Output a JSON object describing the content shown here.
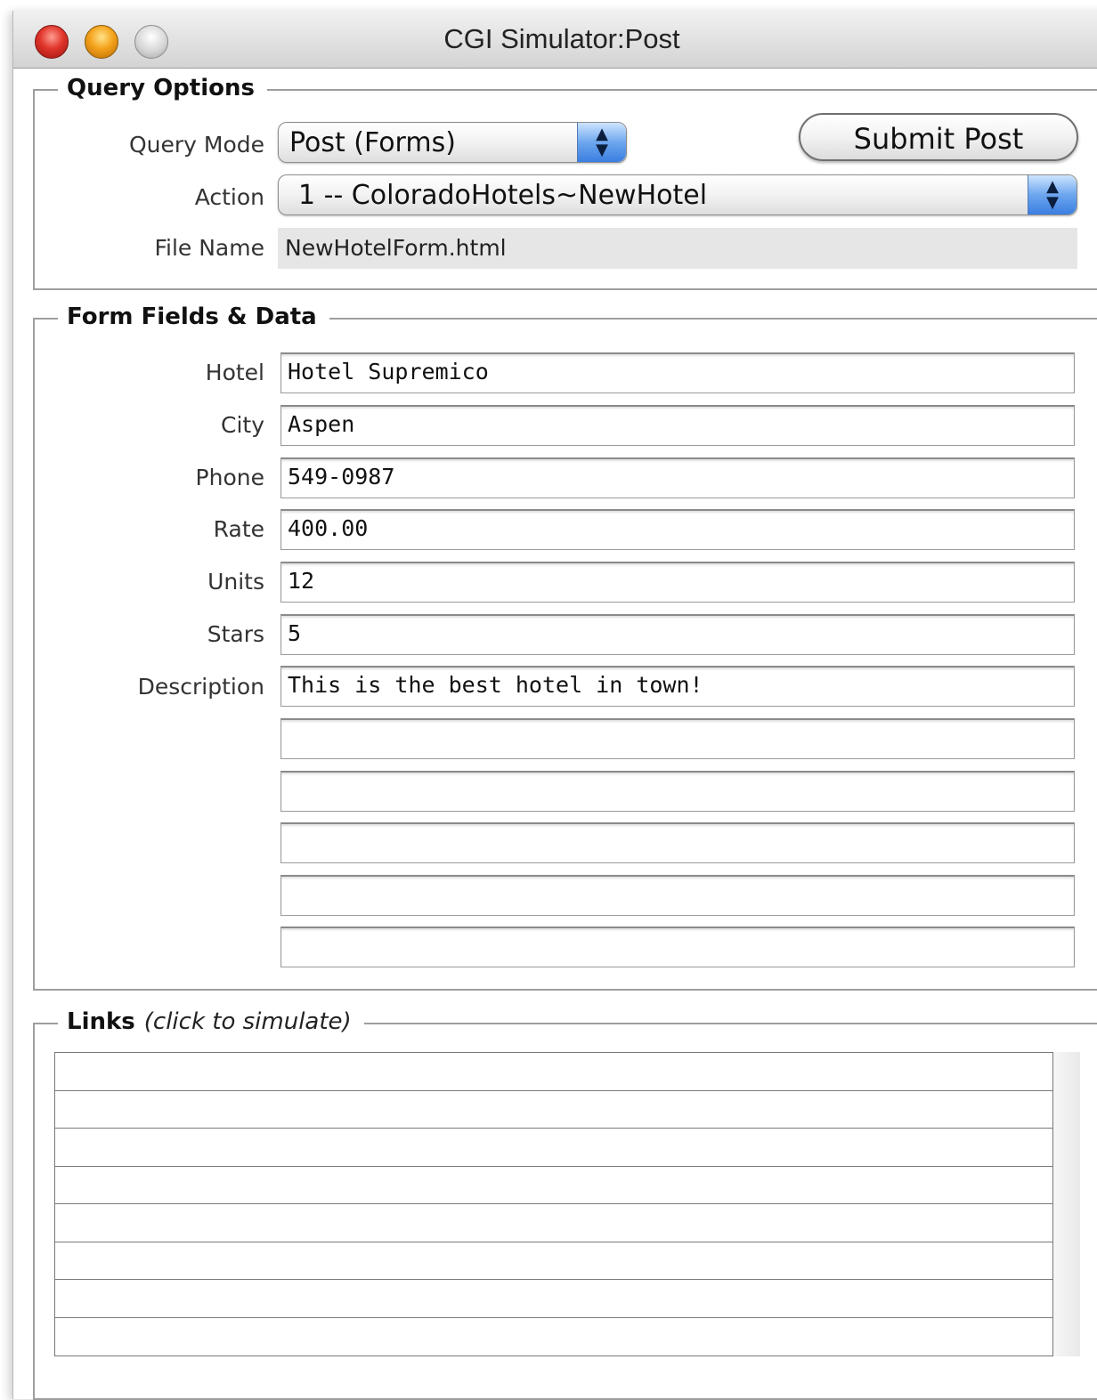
{
  "window": {
    "title": "CGI Simulator:Post"
  },
  "query_options": {
    "legend": "Query Options",
    "query_mode_label": "Query Mode",
    "query_mode_value": "Post (Forms)",
    "submit_label": "Submit Post",
    "action_label": "Action",
    "action_value": "1 -- ColoradoHotels~NewHotel",
    "file_name_label": "File Name",
    "file_name_value": "NewHotelForm.html"
  },
  "form_fields": {
    "legend": "Form Fields & Data",
    "rows": [
      {
        "label": "Hotel",
        "value": "Hotel Supremico"
      },
      {
        "label": "City",
        "value": "Aspen"
      },
      {
        "label": "Phone",
        "value": "549-0987"
      },
      {
        "label": "Rate",
        "value": "400.00"
      },
      {
        "label": "Units",
        "value": "12"
      },
      {
        "label": "Stars",
        "value": "5"
      },
      {
        "label": "Description",
        "value": "This is the best hotel in town!"
      },
      {
        "label": "",
        "value": ""
      },
      {
        "label": "",
        "value": ""
      },
      {
        "label": "",
        "value": ""
      },
      {
        "label": "",
        "value": ""
      },
      {
        "label": "",
        "value": ""
      }
    ]
  },
  "links": {
    "legend": "Links",
    "hint": "(click to simulate)",
    "rows": [
      "",
      "",
      "",
      "",
      "",
      "",
      "",
      ""
    ]
  }
}
